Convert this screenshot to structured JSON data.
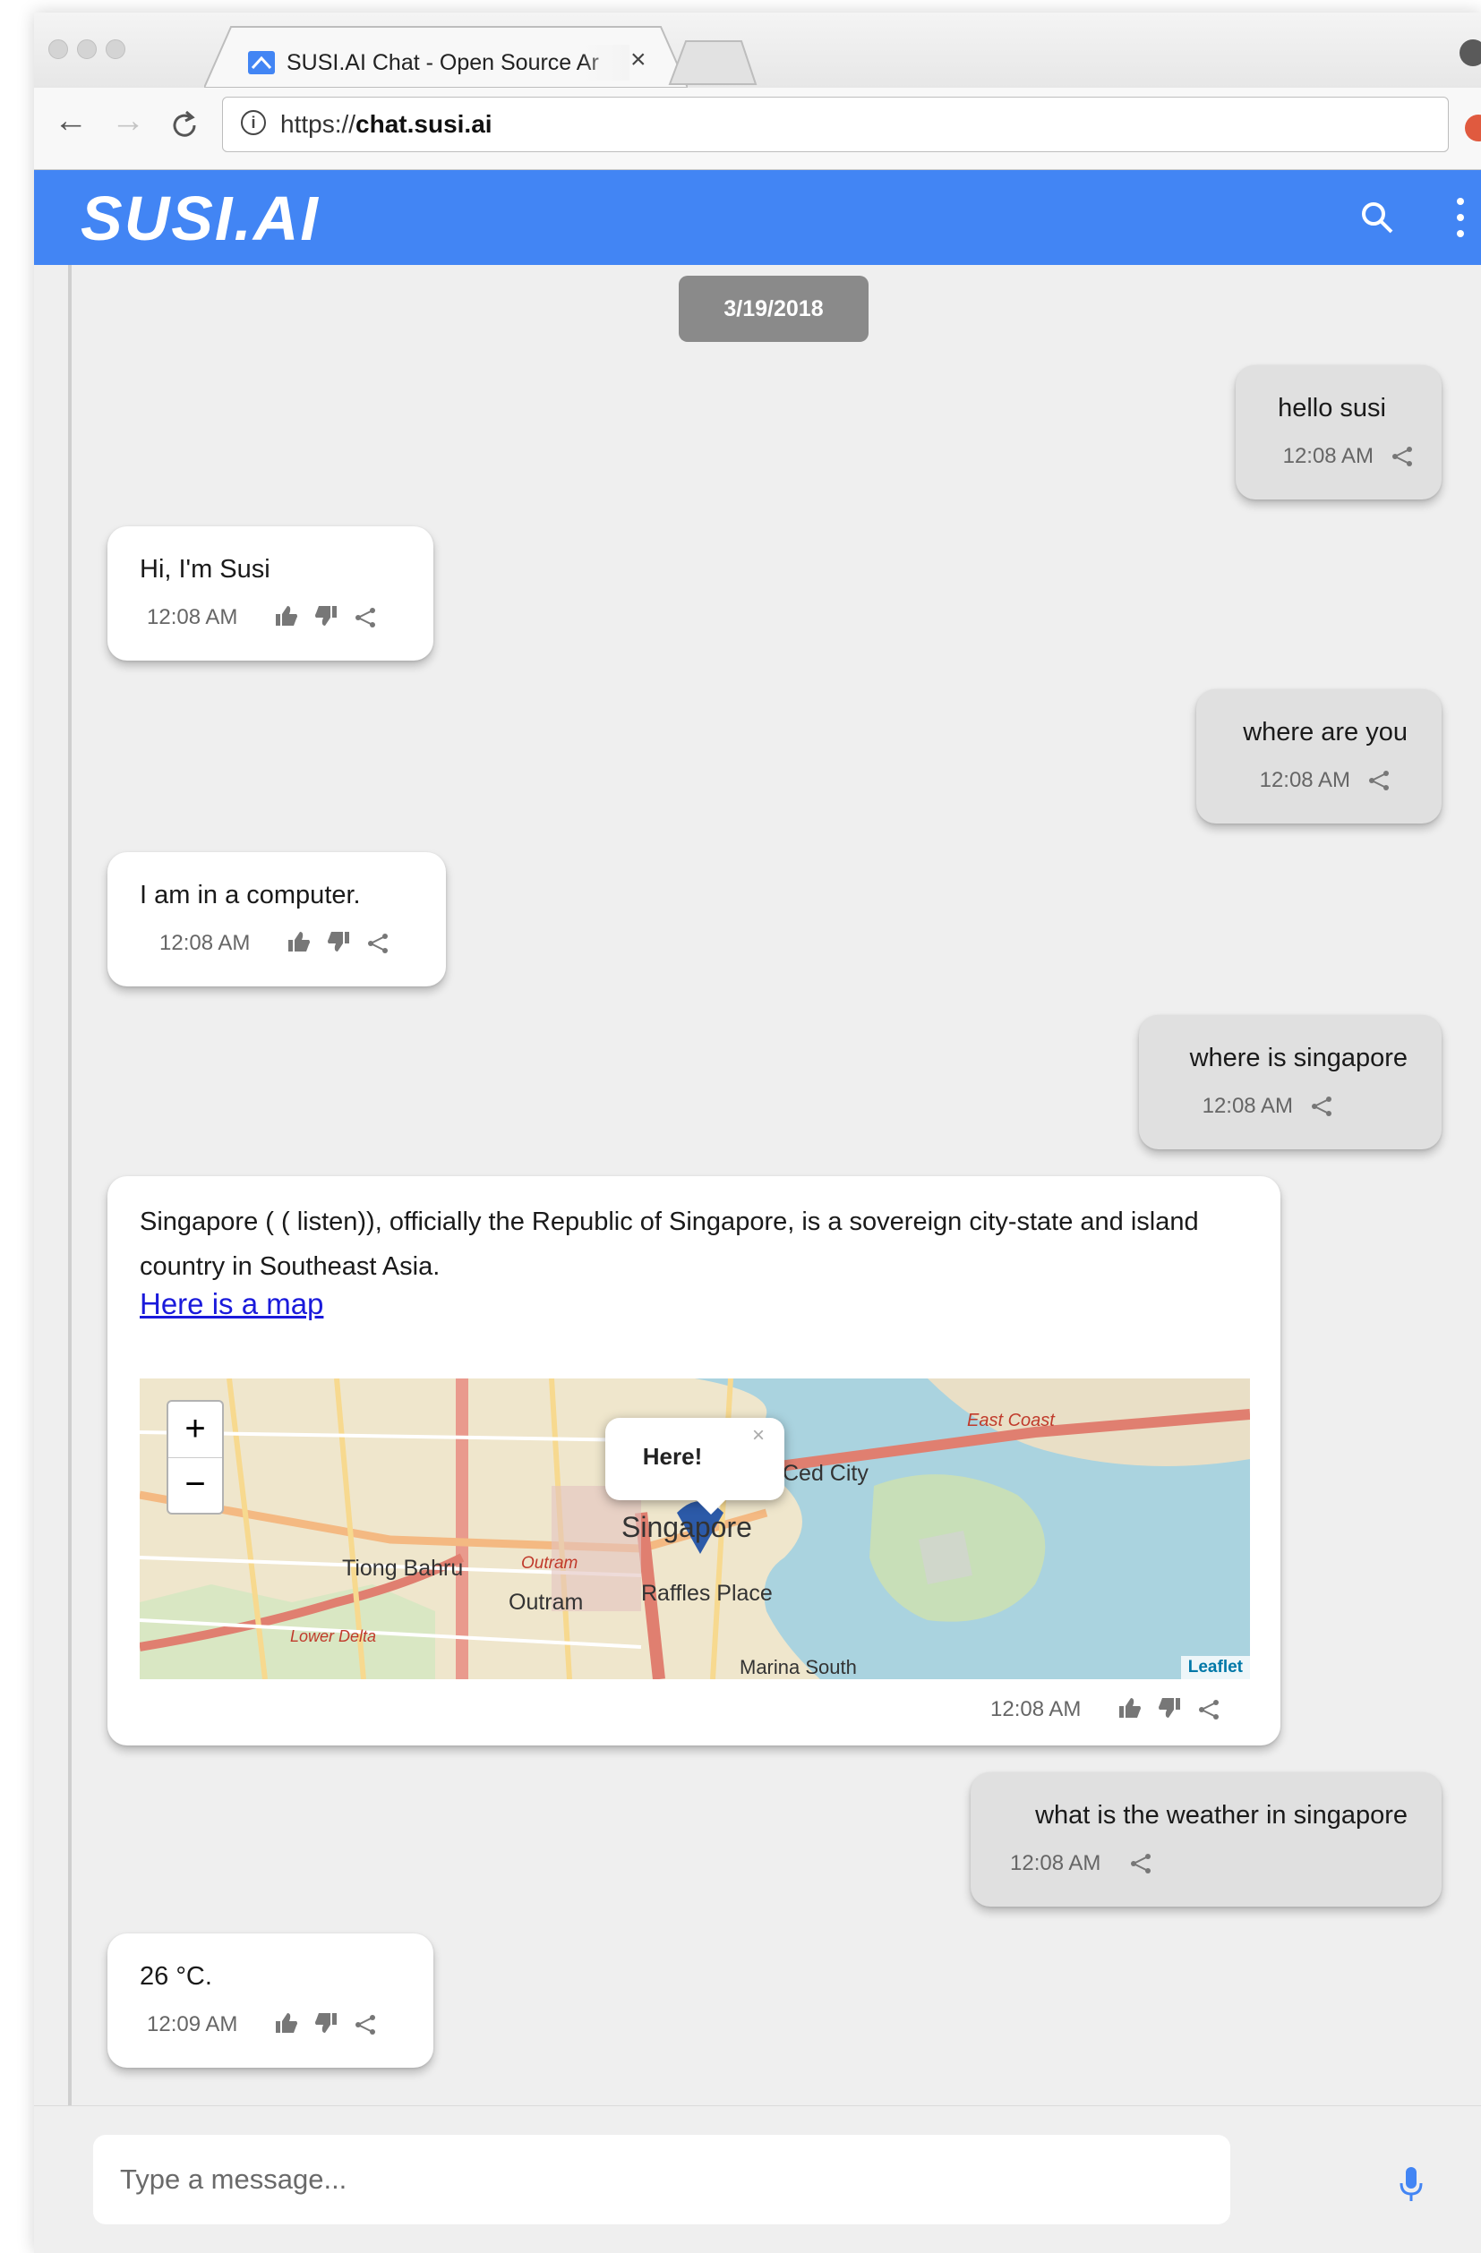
{
  "browser": {
    "tab_title": "SUSI.AI Chat - Open Source Ar",
    "tab_close": "×",
    "url_scheme": "https://",
    "url_host": "chat.susi.ai"
  },
  "app": {
    "logo": "SUSI.AI",
    "brand_color": "#4285f4"
  },
  "chat": {
    "date": "3/19/2018",
    "messages": [
      {
        "from": "user",
        "text": "hello susi",
        "time": "12:08 AM"
      },
      {
        "from": "bot",
        "text": "Hi, I'm Susi",
        "time": "12:08 AM"
      },
      {
        "from": "user",
        "text": "where are you",
        "time": "12:08 AM"
      },
      {
        "from": "bot",
        "text": "I am in a computer.",
        "time": "12:08 AM"
      },
      {
        "from": "user",
        "text": "where is singapore",
        "time": "12:08 AM"
      },
      {
        "from": "bot",
        "text": "Singapore ( ( listen)), officially the Republic of Singapore, is a sovereign city-state and island country in Southeast Asia.",
        "link": "Here is a map",
        "time": "12:08 AM"
      },
      {
        "from": "user",
        "text": "what is the weather in singapore",
        "time": "12:08 AM"
      },
      {
        "from": "bot",
        "text": "26 °C.",
        "time": "12:09 AM"
      }
    ]
  },
  "map": {
    "zoom_in": "+",
    "zoom_out": "−",
    "popup": "Here!",
    "popup_close": "×",
    "attribution": "Leaflet",
    "labels": {
      "singapore": "Singapore",
      "tiong_bahru": "Tiong Bahru",
      "outram": "Outram",
      "outram_park": "Outram",
      "raffles_place": "Raffles Place",
      "east_coast": "East Coast",
      "city": "Ced City",
      "lower_delta": "Lower Delta",
      "marina_south": "Marina South"
    }
  },
  "input": {
    "placeholder": "Type a message..."
  }
}
